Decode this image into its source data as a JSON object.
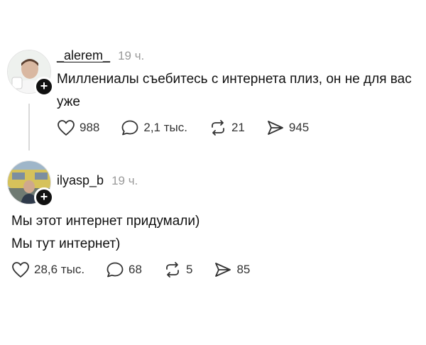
{
  "posts": [
    {
      "username": "_alerem_",
      "time": "19 ч.",
      "text": "Миллениалы съебитесь с интернета плиз, он не для вас уже",
      "likes": "988",
      "replies": "2,1 тыс.",
      "reposts": "21",
      "shares": "945"
    },
    {
      "username": "ilyasp_b",
      "time": "19 ч.",
      "text_lines": [
        "Мы этот интернет придумали)",
        "Мы тут интернет)"
      ],
      "likes": "28,6 тыс.",
      "replies": "68",
      "reposts": "5",
      "shares": "85"
    }
  ],
  "icons": {
    "like": "heart-icon",
    "reply": "comment-icon",
    "repost": "repost-icon",
    "share": "send-icon",
    "follow": "plus-icon"
  }
}
